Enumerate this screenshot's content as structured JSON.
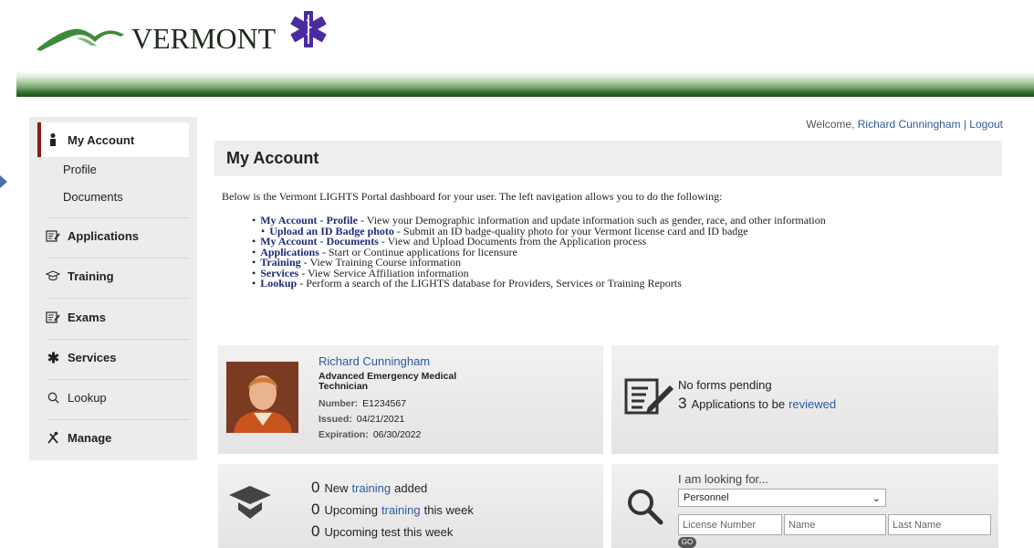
{
  "header": {
    "logo_text": "VERMONT"
  },
  "user": {
    "welcome_prefix": "Welcome, ",
    "name": "Richard Cunningham",
    "separator": " | ",
    "logout": "Logout"
  },
  "sidebar": {
    "my_account": "My Account",
    "profile": "Profile",
    "documents": "Documents",
    "applications": "Applications",
    "training": "Training",
    "exams": "Exams",
    "services": "Services",
    "lookup": "Lookup",
    "manage": "Manage"
  },
  "page": {
    "title": "My Account",
    "intro": "Below is the Vermont LIGHTS Portal dashboard for your user. The left navigation allows you to do the following:",
    "links": [
      {
        "label": "My Account - Profile",
        "desc": " - View your Demographic information and update information such as gender, race, and other information"
      },
      {
        "label": "Upload an ID Badge photo",
        "desc": " - Submit an ID badge-quality photo for your Vermont license card and ID badge"
      },
      {
        "label": "My Account - Documents",
        "desc": " - View and Upload Documents from the Application process"
      },
      {
        "label": "Applications",
        "desc": " - Start or Continue applications for licensure"
      },
      {
        "label": "Training",
        "desc": " - View Training Course information"
      },
      {
        "label": "Services",
        "desc": " - View Service Affiliation information"
      },
      {
        "label": "Lookup",
        "desc": " - Perform a search of the LIGHTS database for Providers, Services or Training Reports"
      }
    ]
  },
  "profile_card": {
    "name": "Richard Cunningham",
    "title": "Advanced Emergency Medical Technician",
    "number_label": "Number:",
    "number": "E1234567",
    "issued_label": "Issued:",
    "issued": "04/21/2021",
    "expiration_label": "Expiration:",
    "expiration": "06/30/2022"
  },
  "forms_card": {
    "pending": "No forms pending",
    "apps_count": "3",
    "apps_text": "Applications to be",
    "apps_link": "reviewed"
  },
  "training_card": {
    "new_count": "0",
    "new_pre": "New",
    "new_link": "training",
    "new_post": "added",
    "upcoming_count": "0",
    "upcoming_pre": "Upcoming",
    "upcoming_link": "training",
    "upcoming_post": "this week",
    "test_count": "0",
    "test_text": "Upcoming test this week"
  },
  "lookup_card": {
    "label": "I am looking for...",
    "selected": "Personnel",
    "license_placeholder": "License Number",
    "name_placeholder": "Name",
    "last_name_placeholder": "Last Name",
    "go": "GO"
  },
  "colors": {
    "accent_red": "#8b1a1a",
    "link_blue": "#2b5aa0",
    "header_green": "#1f531c"
  }
}
